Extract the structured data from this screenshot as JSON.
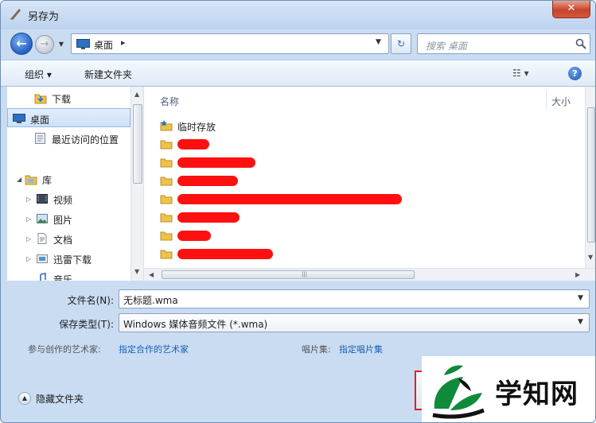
{
  "window": {
    "title": "另存为",
    "close_label": "✕"
  },
  "nav": {
    "back_label": "←",
    "forward_label": "→",
    "address_text": "桌面",
    "address_separator": "▸",
    "search_placeholder": "搜索 桌面"
  },
  "toolbar": {
    "organize_label": "组织 ▾",
    "new_folder_label": "新建文件夹",
    "view_label": "☷ ▾",
    "help_label": "?"
  },
  "sidebar": {
    "items": [
      {
        "label": "下载",
        "icon": "download-folder-icon"
      },
      {
        "label": "桌面",
        "icon": "desktop-icon",
        "selected": true
      },
      {
        "label": "最近访问的位置",
        "icon": "recent-places-icon"
      },
      {
        "label": "库",
        "icon": "library-icon"
      },
      {
        "label": "视频",
        "icon": "video-library-icon"
      },
      {
        "label": "图片",
        "icon": "pictures-library-icon"
      },
      {
        "label": "文档",
        "icon": "documents-library-icon"
      },
      {
        "label": "迅雷下载",
        "icon": "thunder-download-icon"
      },
      {
        "label": "音乐",
        "icon": "music-library-icon"
      }
    ]
  },
  "files": {
    "column_name": "名称",
    "column_size": "大小",
    "items": [
      {
        "label": "临时存放",
        "icon": "starred-folder-icon"
      }
    ]
  },
  "form": {
    "filename_label": "文件名(N):",
    "filename_value": "无标题.wma",
    "savetype_label": "保存类型(T):",
    "savetype_value": "Windows 媒体音频文件 (*.wma)",
    "artist_label": "参与创作的艺术家:",
    "artist_link": "指定合作的艺术家",
    "album_label": "唱片集:",
    "album_link": "指定唱片集"
  },
  "footer": {
    "hide_folders_label": "隐藏文件夹"
  },
  "watermark": {
    "text": "学知网"
  },
  "colors": {
    "accent": "#1a5fb0",
    "redaction": "#ff1010",
    "frame": "#c9dcf2"
  }
}
